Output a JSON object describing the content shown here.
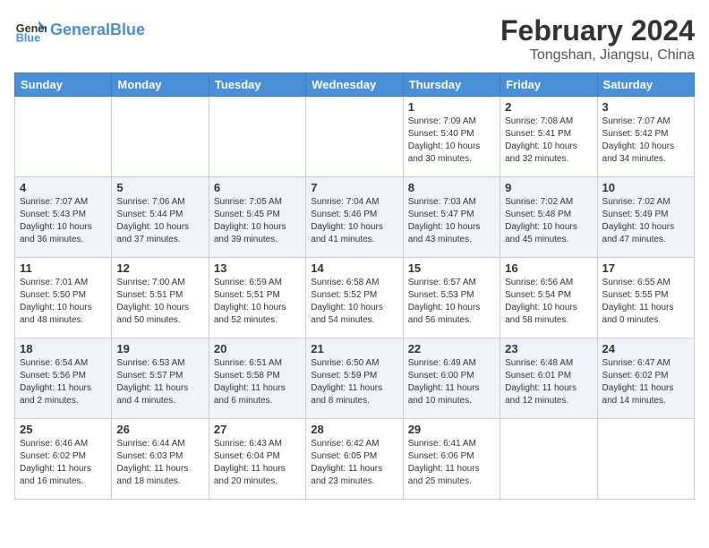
{
  "logo": {
    "text_general": "General",
    "text_blue": "Blue"
  },
  "header": {
    "month": "February 2024",
    "location": "Tongshan, Jiangsu, China"
  },
  "weekdays": [
    "Sunday",
    "Monday",
    "Tuesday",
    "Wednesday",
    "Thursday",
    "Friday",
    "Saturday"
  ],
  "weeks": [
    [
      {
        "day": "",
        "info": ""
      },
      {
        "day": "",
        "info": ""
      },
      {
        "day": "",
        "info": ""
      },
      {
        "day": "",
        "info": ""
      },
      {
        "day": "1",
        "info": "Sunrise: 7:09 AM\nSunset: 5:40 PM\nDaylight: 10 hours\nand 30 minutes."
      },
      {
        "day": "2",
        "info": "Sunrise: 7:08 AM\nSunset: 5:41 PM\nDaylight: 10 hours\nand 32 minutes."
      },
      {
        "day": "3",
        "info": "Sunrise: 7:07 AM\nSunset: 5:42 PM\nDaylight: 10 hours\nand 34 minutes."
      }
    ],
    [
      {
        "day": "4",
        "info": "Sunrise: 7:07 AM\nSunset: 5:43 PM\nDaylight: 10 hours\nand 36 minutes."
      },
      {
        "day": "5",
        "info": "Sunrise: 7:06 AM\nSunset: 5:44 PM\nDaylight: 10 hours\nand 37 minutes."
      },
      {
        "day": "6",
        "info": "Sunrise: 7:05 AM\nSunset: 5:45 PM\nDaylight: 10 hours\nand 39 minutes."
      },
      {
        "day": "7",
        "info": "Sunrise: 7:04 AM\nSunset: 5:46 PM\nDaylight: 10 hours\nand 41 minutes."
      },
      {
        "day": "8",
        "info": "Sunrise: 7:03 AM\nSunset: 5:47 PM\nDaylight: 10 hours\nand 43 minutes."
      },
      {
        "day": "9",
        "info": "Sunrise: 7:02 AM\nSunset: 5:48 PM\nDaylight: 10 hours\nand 45 minutes."
      },
      {
        "day": "10",
        "info": "Sunrise: 7:02 AM\nSunset: 5:49 PM\nDaylight: 10 hours\nand 47 minutes."
      }
    ],
    [
      {
        "day": "11",
        "info": "Sunrise: 7:01 AM\nSunset: 5:50 PM\nDaylight: 10 hours\nand 48 minutes."
      },
      {
        "day": "12",
        "info": "Sunrise: 7:00 AM\nSunset: 5:51 PM\nDaylight: 10 hours\nand 50 minutes."
      },
      {
        "day": "13",
        "info": "Sunrise: 6:59 AM\nSunset: 5:51 PM\nDaylight: 10 hours\nand 52 minutes."
      },
      {
        "day": "14",
        "info": "Sunrise: 6:58 AM\nSunset: 5:52 PM\nDaylight: 10 hours\nand 54 minutes."
      },
      {
        "day": "15",
        "info": "Sunrise: 6:57 AM\nSunset: 5:53 PM\nDaylight: 10 hours\nand 56 minutes."
      },
      {
        "day": "16",
        "info": "Sunrise: 6:56 AM\nSunset: 5:54 PM\nDaylight: 10 hours\nand 58 minutes."
      },
      {
        "day": "17",
        "info": "Sunrise: 6:55 AM\nSunset: 5:55 PM\nDaylight: 11 hours\nand 0 minutes."
      }
    ],
    [
      {
        "day": "18",
        "info": "Sunrise: 6:54 AM\nSunset: 5:56 PM\nDaylight: 11 hours\nand 2 minutes."
      },
      {
        "day": "19",
        "info": "Sunrise: 6:53 AM\nSunset: 5:57 PM\nDaylight: 11 hours\nand 4 minutes."
      },
      {
        "day": "20",
        "info": "Sunrise: 6:51 AM\nSunset: 5:58 PM\nDaylight: 11 hours\nand 6 minutes."
      },
      {
        "day": "21",
        "info": "Sunrise: 6:50 AM\nSunset: 5:59 PM\nDaylight: 11 hours\nand 8 minutes."
      },
      {
        "day": "22",
        "info": "Sunrise: 6:49 AM\nSunset: 6:00 PM\nDaylight: 11 hours\nand 10 minutes."
      },
      {
        "day": "23",
        "info": "Sunrise: 6:48 AM\nSunset: 6:01 PM\nDaylight: 11 hours\nand 12 minutes."
      },
      {
        "day": "24",
        "info": "Sunrise: 6:47 AM\nSunset: 6:02 PM\nDaylight: 11 hours\nand 14 minutes."
      }
    ],
    [
      {
        "day": "25",
        "info": "Sunrise: 6:46 AM\nSunset: 6:02 PM\nDaylight: 11 hours\nand 16 minutes."
      },
      {
        "day": "26",
        "info": "Sunrise: 6:44 AM\nSunset: 6:03 PM\nDaylight: 11 hours\nand 18 minutes."
      },
      {
        "day": "27",
        "info": "Sunrise: 6:43 AM\nSunset: 6:04 PM\nDaylight: 11 hours\nand 20 minutes."
      },
      {
        "day": "28",
        "info": "Sunrise: 6:42 AM\nSunset: 6:05 PM\nDaylight: 11 hours\nand 23 minutes."
      },
      {
        "day": "29",
        "info": "Sunrise: 6:41 AM\nSunset: 6:06 PM\nDaylight: 11 hours\nand 25 minutes."
      },
      {
        "day": "",
        "info": ""
      },
      {
        "day": "",
        "info": ""
      }
    ]
  ]
}
